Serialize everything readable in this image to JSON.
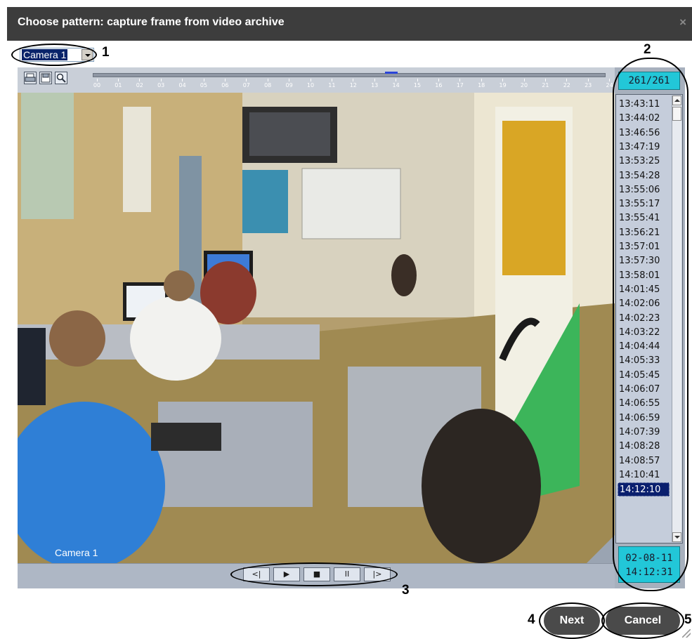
{
  "dialog": {
    "title": "Choose pattern: capture frame from video archive",
    "close_glyph": "×"
  },
  "camera_select": {
    "value": "Camera 1"
  },
  "timeline": {
    "ticks": [
      "00",
      "01",
      "02",
      "03",
      "04",
      "05",
      "06",
      "07",
      "08",
      "09",
      "10",
      "11",
      "12",
      "13",
      "14",
      "15",
      "16",
      "17",
      "18",
      "19",
      "20",
      "21",
      "22",
      "23",
      "24"
    ]
  },
  "video": {
    "overlay_label": "Camera 1"
  },
  "frames": {
    "counter": "261/261",
    "times": [
      "13:43:11",
      "13:44:02",
      "13:46:56",
      "13:47:19",
      "13:53:25",
      "13:54:28",
      "13:55:06",
      "13:55:17",
      "13:55:41",
      "13:56:21",
      "13:57:01",
      "13:57:30",
      "13:58:01",
      "14:01:45",
      "14:02:06",
      "14:02:23",
      "14:03:22",
      "14:04:44",
      "14:05:33",
      "14:05:45",
      "14:06:07",
      "14:06:55",
      "14:06:59",
      "14:07:39",
      "14:08:28",
      "14:08:57",
      "14:10:41",
      "14:12:10"
    ],
    "selected": "14:12:10",
    "date": "02-08-11",
    "time": "14:12:31"
  },
  "playback": {
    "prev": "<|",
    "play": "▶",
    "stop": "■",
    "pause": "II",
    "next": "|>"
  },
  "buttons": {
    "next": "Next",
    "cancel": "Cancel"
  },
  "callouts": {
    "n1": "1",
    "n2": "2",
    "n3": "3",
    "n4": "4",
    "n5": "5"
  },
  "colors": {
    "accent": "#22c7d8",
    "selection": "#0a1f6e",
    "titlebar": "#3d3d3d"
  }
}
